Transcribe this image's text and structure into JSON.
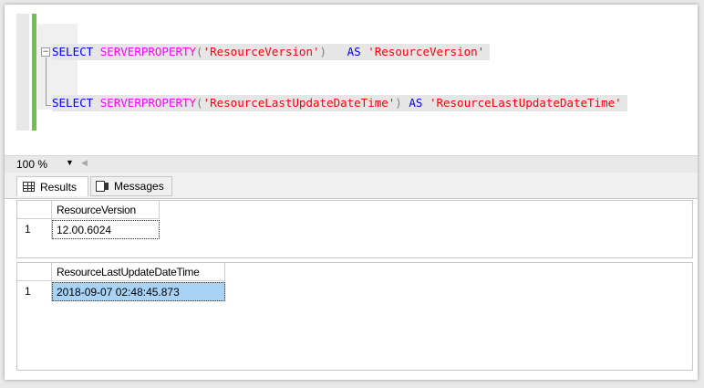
{
  "editor": {
    "query1": {
      "select": "SELECT",
      "func": "SERVERPROPERTY",
      "open": "(",
      "arg": "'ResourceVersion'",
      "close": ")",
      "spacer": "  ",
      "as": "AS",
      "alias": "'ResourceVersion'"
    },
    "query2": {
      "select": "SELECT",
      "func": "SERVERPROPERTY",
      "open": "(",
      "arg": "'ResourceLastUpdateDateTime'",
      "close": ")",
      "as": "AS",
      "alias": "'ResourceLastUpdateDateTime'"
    },
    "collapse_symbol": "−"
  },
  "zoom": {
    "value": "100 %",
    "arrow": "▼",
    "scroll_left": "◀"
  },
  "tabs": [
    {
      "label": "Results",
      "icon": "grid-icon",
      "active": true
    },
    {
      "label": "Messages",
      "icon": "messages-icon",
      "active": false
    }
  ],
  "results": [
    {
      "columns": [
        "ResourceVersion"
      ],
      "rows": [
        {
          "num": "1",
          "cells": [
            "12.00.6024"
          ]
        }
      ]
    },
    {
      "columns": [
        "ResourceLastUpdateDateTime"
      ],
      "rows": [
        {
          "num": "1",
          "cells": [
            "2018-09-07 02:48:45.873"
          ]
        }
      ]
    }
  ],
  "colors": {
    "keyword": "#0000ff",
    "function": "#ff00ff",
    "string": "#ff0000",
    "change_bar": "#6cc24a",
    "selected_cell": "#a8d3f5"
  }
}
